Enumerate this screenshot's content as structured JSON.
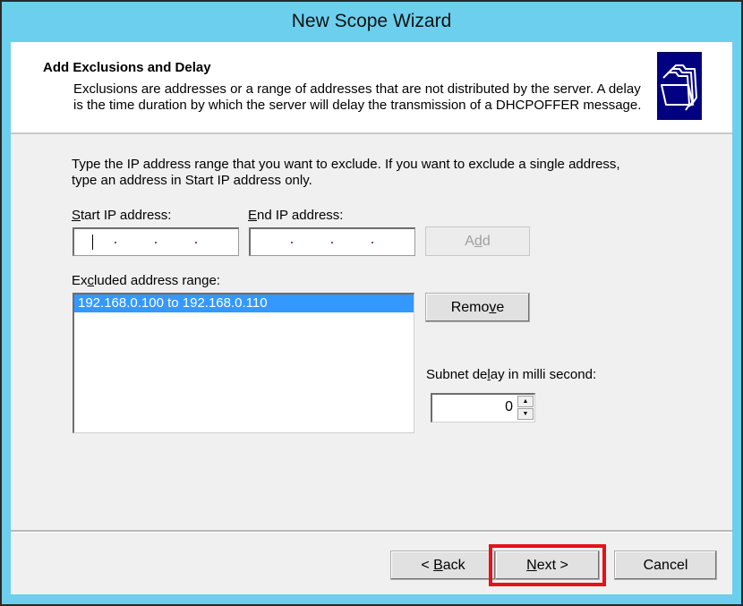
{
  "window": {
    "title": "New Scope Wizard"
  },
  "header": {
    "title": "Add Exclusions and Delay",
    "description": "Exclusions are addresses or a range of addresses that are not distributed by the server. A delay is the time duration by which the server will delay the transmission of a DHCPOFFER message.",
    "icon": "folders-icon"
  },
  "body": {
    "instruction": "Type the IP address range that you want to exclude. If you want to exclude a single address, type an address in Start IP address only.",
    "start_ip": {
      "label_accel": "S",
      "label_rest": "tart IP address:",
      "value": ""
    },
    "end_ip": {
      "label_accel": "E",
      "label_rest": "nd IP address:",
      "value": ""
    },
    "add_button": {
      "pre": "A",
      "accel": "d",
      "post": "d",
      "enabled": false
    },
    "excluded_label": {
      "pre": "Ex",
      "accel": "c",
      "post": "luded address range:"
    },
    "excluded_ranges": [
      "192.168.0.100 to 192.168.0.110"
    ],
    "remove_button": {
      "pre": "Remo",
      "accel": "v",
      "post": "e"
    },
    "delay_label": {
      "pre": "Subnet de",
      "accel": "l",
      "post": "ay in milli second:"
    },
    "delay_value": "0"
  },
  "footer": {
    "back": {
      "pre": "< ",
      "accel": "B",
      "post": "ack"
    },
    "next": {
      "accel": "N",
      "post": "ext >"
    },
    "cancel": "Cancel",
    "highlight_color": "#e8111b"
  }
}
